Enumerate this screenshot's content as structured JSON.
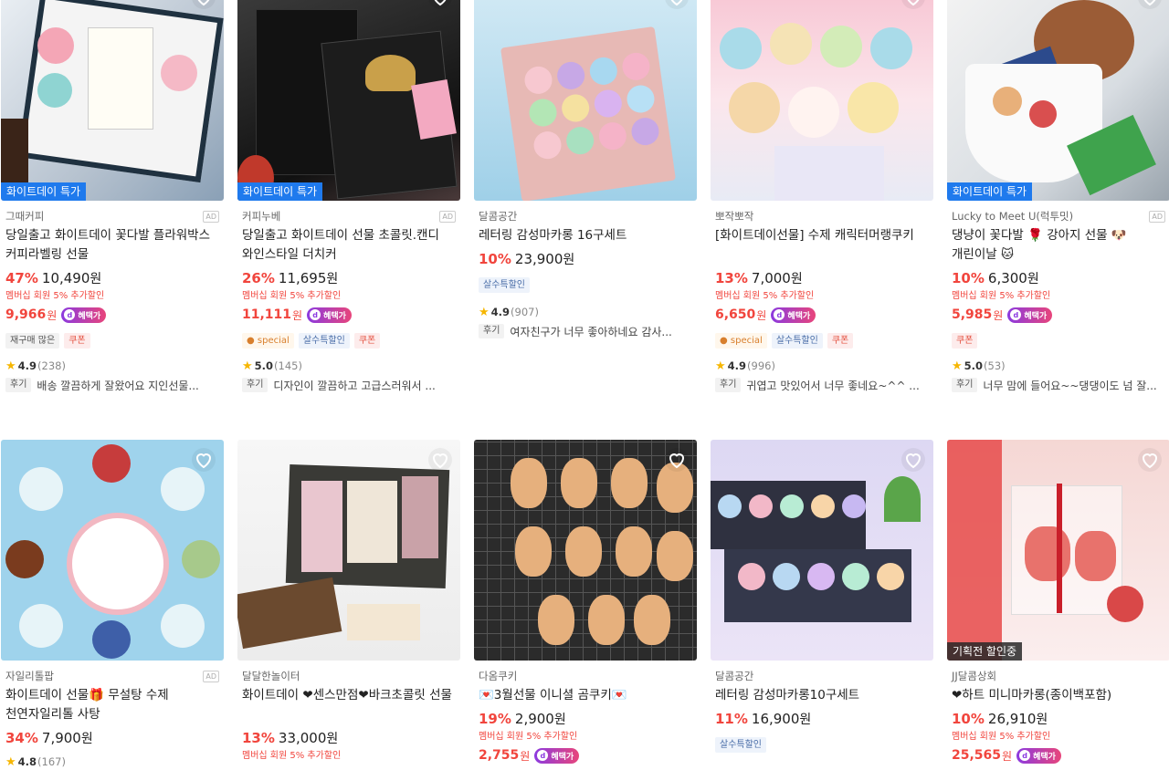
{
  "products": [
    {
      "badge": "화이트데이 특가",
      "artist": "그때커피",
      "ad": "AD",
      "title": "당일출고 화이트데이 꽃다발 플라워박스 커피라벨링 선물",
      "discount": "47%",
      "price": "10,490",
      "won": "원",
      "member_note": "멤버십 회원 5% 추가할인",
      "member_price": "9,966",
      "member_won": "원",
      "benefit": "혜택가",
      "chips": [
        "재구매 많은",
        "쿠폰"
      ],
      "rating": "4.9",
      "rating_count": "(238)",
      "review_tag": "후기",
      "review": "배송 깔끔하게 잘왔어요 지인선물..."
    },
    {
      "badge": "화이트데이 특가",
      "artist": "커피누베",
      "ad": "AD",
      "title": "당일출고 화이트데이 선물 초콜릿.캔디 와인스타일 더치커",
      "discount": "26%",
      "price": "11,695",
      "won": "원",
      "member_note": "멤버십 회원 5% 추가할인",
      "member_price": "11,111",
      "member_won": "원",
      "benefit": "혜택가",
      "chips": [
        "special",
        "살수특할인",
        "쿠폰"
      ],
      "rating": "5.0",
      "rating_count": "(145)",
      "review_tag": "후기",
      "review": "디자인이 깔끔하고 고급스러워서 ..."
    },
    {
      "artist": "달콤공간",
      "title": "레터링 감성마카롱 16구세트",
      "discount": "10%",
      "price": "23,900",
      "won": "원",
      "chips": [
        "살수특할인"
      ],
      "rating": "4.9",
      "rating_count": "(907)",
      "review_tag": "후기",
      "review": "여자친구가 너무 좋아하네요 감사..."
    },
    {
      "artist": "뽀작뽀작",
      "title": "[화이트데이선물] 수제 캐릭터머랭쿠키",
      "discount": "13%",
      "price": "7,000",
      "won": "원",
      "member_note": "멤버십 회원 5% 추가할인",
      "member_price": "6,650",
      "member_won": "원",
      "benefit": "혜택가",
      "chips": [
        "special",
        "살수특할인",
        "쿠폰"
      ],
      "rating": "4.9",
      "rating_count": "(996)",
      "review_tag": "후기",
      "review": "귀엽고 맛있어서 너무 좋네요~^^ ..."
    },
    {
      "badge": "화이트데이 특가",
      "artist": "Lucky to Meet U(럭투밋)",
      "ad": "AD",
      "title": "댕냥이 꽃다발 🌹 강아지 선물 🐶 개린이날 🐱",
      "discount": "10%",
      "price": "6,300",
      "won": "원",
      "member_note": "멤버십 회원 5% 추가할인",
      "member_price": "5,985",
      "member_won": "원",
      "benefit": "혜택가",
      "chips": [
        "쿠폰"
      ],
      "rating": "5.0",
      "rating_count": "(53)",
      "review_tag": "후기",
      "review": "너무 맘에 들어요~~댕댕이도 넘 잘..."
    },
    {
      "artist": "자일리톨팝",
      "ad": "AD",
      "title": "화이트데이 선물🎁 무설탕 수제 천연자일리톨 사탕",
      "discount": "34%",
      "price": "7,900",
      "won": "원",
      "rating": "4.8",
      "rating_count": "(167)"
    },
    {
      "artist": "달달한놀이터",
      "title": "화이트데이 ❤센스만점❤바크초콜릿 선물",
      "discount": "13%",
      "price": "33,000",
      "won": "원",
      "member_note": "멤버십 회원 5% 추가할인"
    },
    {
      "artist": "다옴쿠키",
      "title": "💌3월선물 이니셜 곰쿠키💌",
      "discount": "19%",
      "price": "2,900",
      "won": "원",
      "member_note": "멤버십 회원 5% 추가할인",
      "member_price": "2,755",
      "member_won": "원",
      "benefit": "혜택가"
    },
    {
      "artist": "달콤공간",
      "title": "레터링 감성마카롱10구세트",
      "discount": "11%",
      "price": "16,900",
      "won": "원",
      "chips": [
        "살수특할인"
      ]
    },
    {
      "badge": "기획전 할인중",
      "artist": "JJ달콤상회",
      "title": "❤하트 미니마카롱(종이백포함)",
      "discount": "10%",
      "price": "26,910",
      "won": "원",
      "member_note": "멤버십 회원 5% 추가할인",
      "member_price": "25,565",
      "member_won": "원",
      "benefit": "혜택가"
    }
  ],
  "colors": {
    "accent": "#f1453d",
    "special_badge": "#1f7aed",
    "star": "#f6b600"
  },
  "icons": {
    "wishlist": "heart-outline-icon",
    "rating": "star-icon"
  }
}
